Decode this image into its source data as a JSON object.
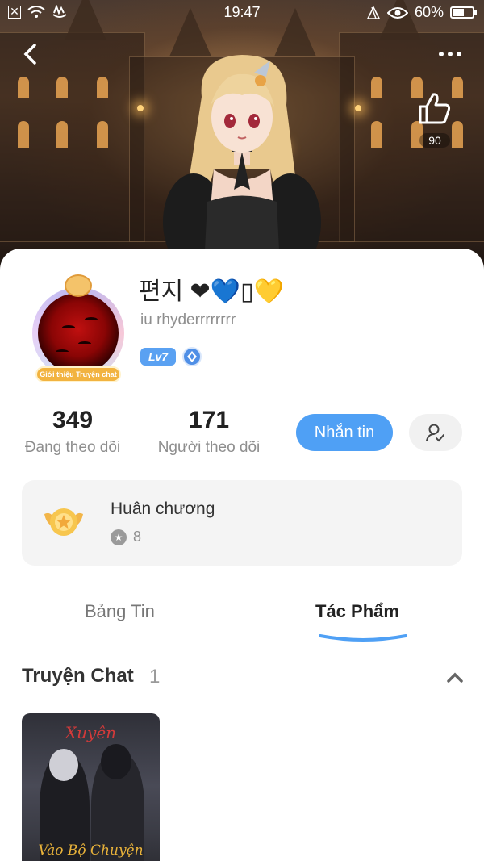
{
  "status_bar": {
    "time": "19:47",
    "battery_text": "60%",
    "battery_level": 0.6,
    "icons": [
      "sim-icon",
      "wifi-icon",
      "notification-icon",
      "nfc-icon",
      "eye-icon",
      "battery-icon"
    ]
  },
  "header": {
    "like_count": "90",
    "icons": [
      "back-icon",
      "more-icon",
      "thumbs-up-icon"
    ]
  },
  "profile": {
    "name": "편지 ❤💙▯💛",
    "handle": "iu rhyderrrrrrrr",
    "level": "Lv7",
    "avatar_badge": "Giới thiệu Truyện chat"
  },
  "stats": {
    "following_count": "349",
    "following_label": "Đang theo dõi",
    "followers_count": "171",
    "followers_label": "Người theo dõi"
  },
  "actions": {
    "message_label": "Nhắn tin"
  },
  "medals": {
    "title": "Huân chương",
    "count": "8"
  },
  "tabs": {
    "feed_label": "Bảng Tin",
    "works_label": "Tác Phẩm",
    "active": "works"
  },
  "section": {
    "title": "Truyện Chat",
    "count": "1"
  },
  "stories": [
    {
      "cover_title": "Xuyên",
      "cover_subtitle": "Vào Bộ Chuyện"
    }
  ],
  "colors": {
    "accent": "#4fa0f5",
    "level_badge": "#5aa1f2",
    "medal_box_bg": "#f4f4f4"
  }
}
